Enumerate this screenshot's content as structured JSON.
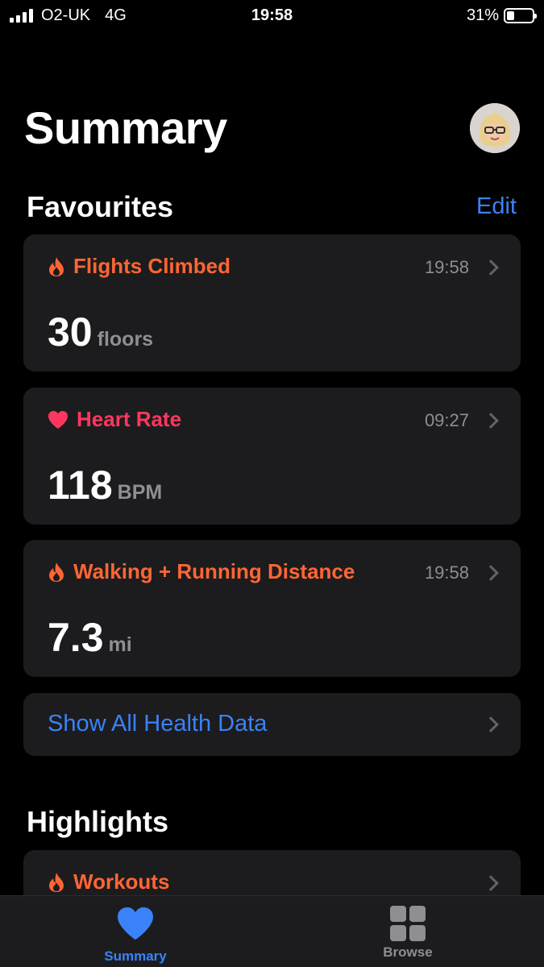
{
  "status_bar": {
    "carrier": "O2-UK",
    "network": "4G",
    "time": "19:58",
    "battery": "31%",
    "battery_level": 0.31
  },
  "header": {
    "title": "Summary"
  },
  "favourites": {
    "title": "Favourites",
    "edit_label": "Edit",
    "cards": [
      {
        "title": "Flights Climbed",
        "time": "19:58",
        "value": "30",
        "unit": "floors",
        "icon": "flame-icon"
      },
      {
        "title": "Heart Rate",
        "time": "09:27",
        "value": "118",
        "unit": "BPM",
        "icon": "heart-icon"
      },
      {
        "title": "Walking + Running Distance",
        "time": "19:58",
        "value": "7.3",
        "unit": "mi",
        "icon": "flame-icon"
      }
    ],
    "show_all_label": "Show All Health Data"
  },
  "highlights": {
    "title": "Highlights",
    "card_title": "Workouts",
    "card_icon": "flame-icon"
  },
  "tab_bar": {
    "tabs": [
      {
        "label": "Summary",
        "icon": "heart-icon",
        "active": true
      },
      {
        "label": "Browse",
        "icon": "grid-icon",
        "active": false
      }
    ]
  },
  "colors": {
    "accent": "#3a82f7",
    "activity_orange": "#ff6634",
    "heart_pink": "#ff375f",
    "card_bg": "#1c1c1e"
  }
}
